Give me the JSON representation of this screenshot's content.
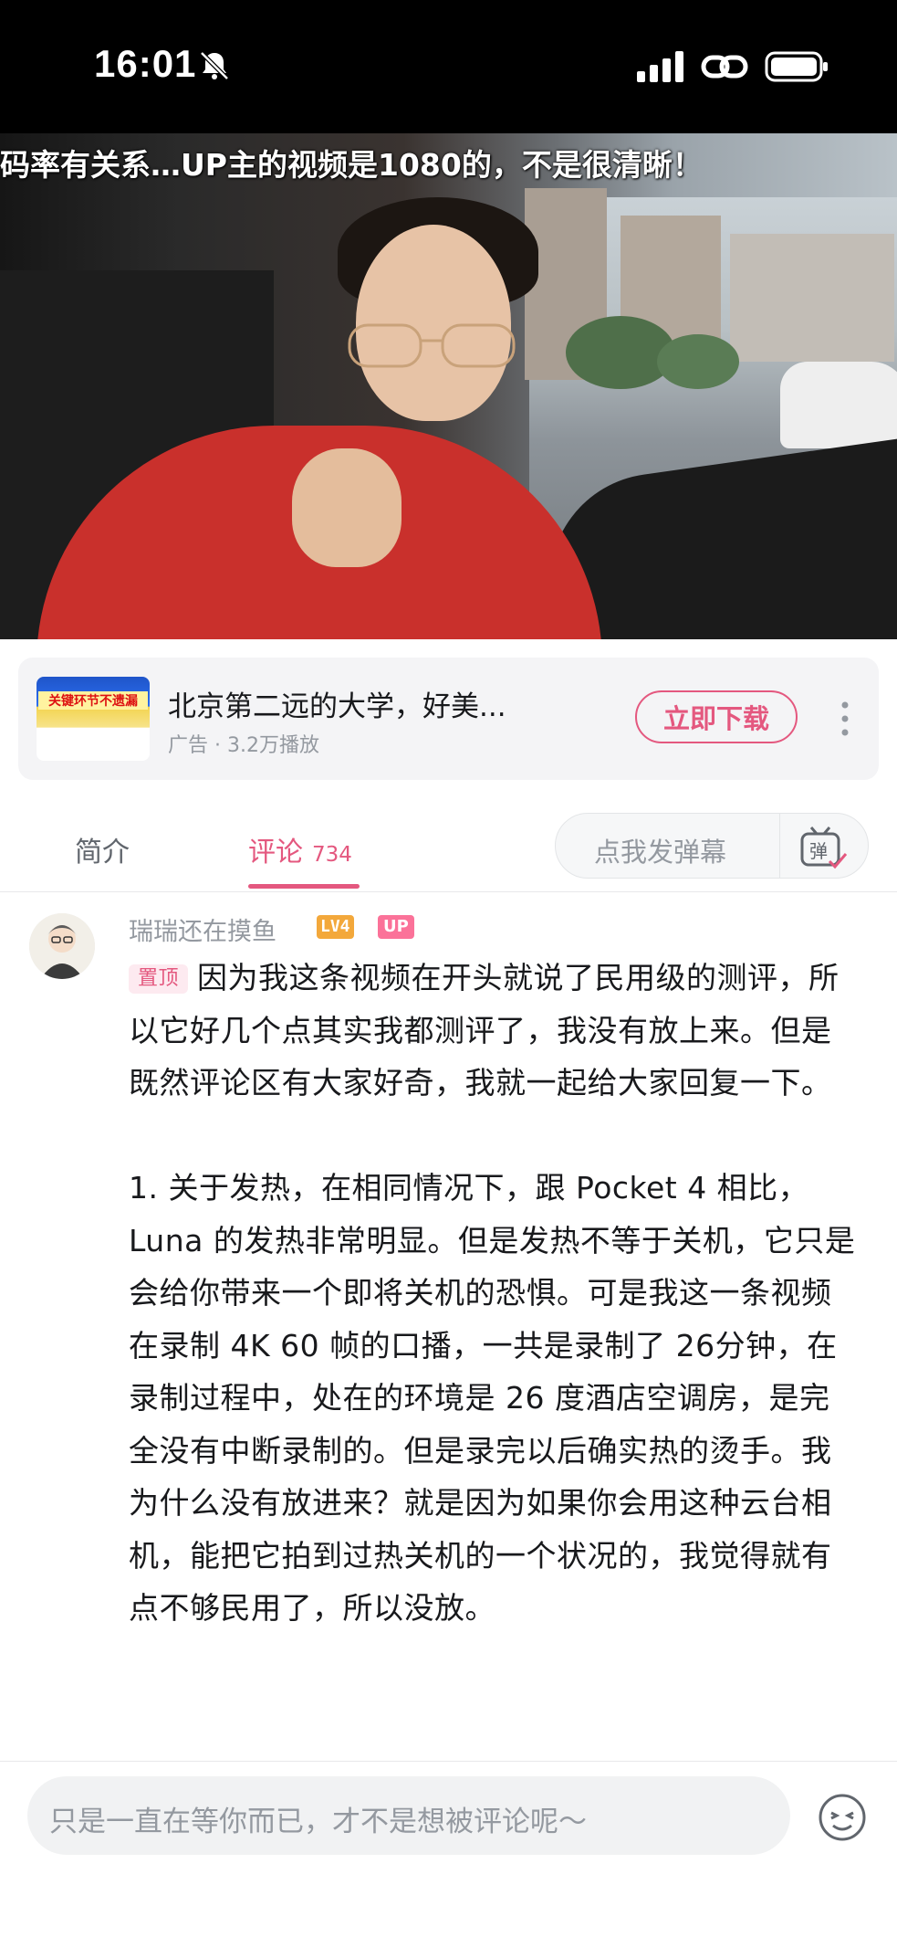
{
  "status_bar": {
    "time": "16:01",
    "icons": [
      "bell-slash-icon",
      "signal-icon",
      "link-icon",
      "battery-icon"
    ]
  },
  "video": {
    "overlay_text": "码率有关系…UP主的视频是1080的，不是很清晰！"
  },
  "ad": {
    "thumb_text": "关键环节不遗漏",
    "title": "北京第二远的大学，好美...",
    "meta": "广告 · 3.2万播放",
    "download_label": "立即下载",
    "more_icon": "more-vertical-icon"
  },
  "tabs": {
    "intro_label": "简介",
    "comment_label": "评论",
    "comment_count": "734",
    "danmaku_placeholder": "点我发弹幕",
    "danmaku_icon": "danmaku-icon",
    "accent_color": "#e4587f"
  },
  "comment": {
    "username": "瑞瑞还在摸鱼",
    "level": "LV4",
    "up_badge": "UP",
    "pin_label": "置顶",
    "paragraph1": "因为我这条视频在开头就说了民用级的测评，所以它好几个点其实我都测评了，我没有放上来。但是既然评论区有大家好奇，我就一起给大家回复一下。",
    "paragraph2": "1. 关于发热，在相同情况下，跟 Pocket 4 相比，Luna 的发热非常明显。但是发热不等于关机，它只是会给你带来一个即将关机的恐惧。可是我这一条视频在录制 4K 60 帧的口播，一共是录制了 26分钟，在录制过程中，处在的环境是 26 度酒店空调房，是完全没有中断录制的。但是录完以后确实热的烫手。我为什么没有放进来？就是因为如果你会用这种云台相机，能把它拍到过热关机的一个状况的，我觉得就有点不够民用了，所以没放。"
  },
  "bottom": {
    "input_placeholder": "只是一直在等你而已，才不是想被评论呢～",
    "emoji_icon": "emoji-icon"
  }
}
